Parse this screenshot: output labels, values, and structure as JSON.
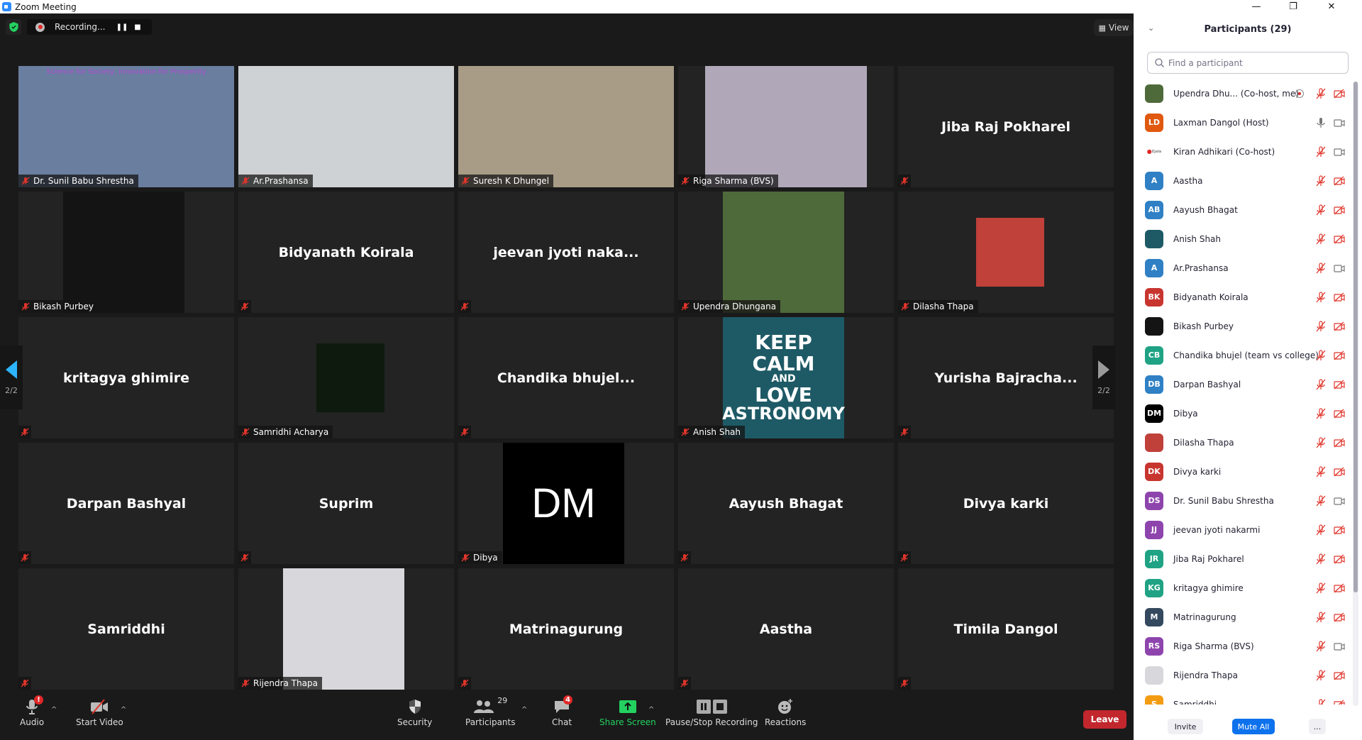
{
  "window": {
    "title": "Zoom Meeting",
    "minimize": "—",
    "restore": "❐",
    "close": "✕"
  },
  "topbar": {
    "recording_label": "Recording...",
    "view_label": "View"
  },
  "pagination": {
    "left": "2/2",
    "right": "2/2"
  },
  "tiles": [
    {
      "name": "Dr. Sunil Babu Shrestha",
      "video": true,
      "bg": "#6a7ea0",
      "banner": "Science for Society, Innovation for Prosperity"
    },
    {
      "name": "Ar.Prashansa",
      "video": true,
      "bg": "#cfd2d4"
    },
    {
      "name": "Suresh K Dhungel",
      "video": true,
      "bg": "#a89c86"
    },
    {
      "name": "Riga Sharma (BVS)",
      "video": true,
      "bg": "#b0a8b8"
    },
    {
      "name": "Jiba Raj Pokharel",
      "video": false
    },
    {
      "name": "Bikash Purbey",
      "video": true,
      "bg": "#141414"
    },
    {
      "name": "Bidyanath Koirala",
      "video": false
    },
    {
      "name": "jeevan jyoti naka...",
      "video": false
    },
    {
      "name": "Upendra Dhungana",
      "video": true,
      "bg": "#4f6a3a"
    },
    {
      "name": "Dilasha Thapa",
      "video": true,
      "bg": "#c0403a"
    },
    {
      "name": "kritagya ghimire",
      "video": false
    },
    {
      "name": "Samridhi Acharya",
      "video": true,
      "bg": "#0d1a0d"
    },
    {
      "name": "Chandika  bhujel...",
      "video": false
    },
    {
      "name": "Anish Shah",
      "video": true,
      "bg": "#1e5a66",
      "poster": [
        "KEEP",
        "CALM",
        "AND",
        "LOVE",
        "ASTRONOMY"
      ]
    },
    {
      "name": "Yurisha  Bajracha...",
      "video": false
    },
    {
      "name": "Darpan Bashyal",
      "video": false
    },
    {
      "name": "Suprim",
      "video": false
    },
    {
      "name": "Dibya",
      "video": true,
      "bg": "#000000",
      "initials": "DM"
    },
    {
      "name": "Aayush Bhagat",
      "video": false
    },
    {
      "name": "Divya karki",
      "video": false
    },
    {
      "name": "Samriddhi",
      "video": false
    },
    {
      "name": "Rijendra Thapa",
      "video": true,
      "bg": "#d8d8dc"
    },
    {
      "name": "Matrinagurung",
      "video": false
    },
    {
      "name": "Aastha",
      "video": false
    },
    {
      "name": "Timila Dangol",
      "video": false
    }
  ],
  "toolbar": {
    "audio": "Audio",
    "audio_badge": "!",
    "video": "Start Video",
    "security": "Security",
    "participants": "Participants",
    "participants_count": "29",
    "chat": "Chat",
    "chat_badge": "4",
    "share": "Share Screen",
    "recording": "Pause/Stop Recording",
    "reactions": "Reactions",
    "leave": "Leave"
  },
  "panel": {
    "title": "Participants (29)",
    "search_placeholder": "Find a participant",
    "participants": [
      {
        "name": "Upendra Dhu... (Co-host, me)",
        "initials": "",
        "color": "#4f6a3a",
        "mic": "off",
        "cam": "off",
        "recording": true
      },
      {
        "name": "Laxman Dangol (Host)",
        "initials": "LD",
        "color": "#e0590f",
        "mic": "on",
        "cam": "on"
      },
      {
        "name": "Kiran Adhikari (Co-host)",
        "initials": "",
        "color": "#ffffff",
        "mic": "off",
        "cam": "on"
      },
      {
        "name": "Aastha",
        "initials": "A",
        "color": "#2f80c4",
        "mic": "off",
        "cam": "off"
      },
      {
        "name": "Aayush Bhagat",
        "initials": "AB",
        "color": "#2f80c4",
        "mic": "off",
        "cam": "off"
      },
      {
        "name": "Anish Shah",
        "initials": "",
        "color": "#1e5a66",
        "mic": "off",
        "cam": "off"
      },
      {
        "name": "Ar.Prashansa",
        "initials": "A",
        "color": "#2f80c4",
        "mic": "off",
        "cam": "on"
      },
      {
        "name": "Bidyanath Koirala",
        "initials": "BK",
        "color": "#c8352f",
        "mic": "off",
        "cam": "off"
      },
      {
        "name": "Bikash Purbey",
        "initials": "",
        "color": "#141414",
        "mic": "off",
        "cam": "off"
      },
      {
        "name": "Chandika bhujel (team vs college)",
        "initials": "CB",
        "color": "#1fa384",
        "mic": "off",
        "cam": "off"
      },
      {
        "name": "Darpan Bashyal",
        "initials": "DB",
        "color": "#2f80c4",
        "mic": "off",
        "cam": "off"
      },
      {
        "name": "Dibya",
        "initials": "DM",
        "color": "#000000",
        "mic": "off",
        "cam": "off"
      },
      {
        "name": "Dilasha Thapa",
        "initials": "",
        "color": "#c0403a",
        "mic": "off",
        "cam": "off"
      },
      {
        "name": "Divya karki",
        "initials": "DK",
        "color": "#c8352f",
        "mic": "off",
        "cam": "off"
      },
      {
        "name": "Dr. Sunil Babu Shrestha",
        "initials": "DS",
        "color": "#8e44ad",
        "mic": "off",
        "cam": "on"
      },
      {
        "name": "jeevan jyoti nakarmi",
        "initials": "JJ",
        "color": "#8e44ad",
        "mic": "off",
        "cam": "off"
      },
      {
        "name": "Jiba Raj Pokharel",
        "initials": "JR",
        "color": "#1fa384",
        "mic": "off",
        "cam": "off"
      },
      {
        "name": "kritagya ghimire",
        "initials": "KG",
        "color": "#1fa384",
        "mic": "off",
        "cam": "off"
      },
      {
        "name": "Matrinagurung",
        "initials": "M",
        "color": "#34495e",
        "mic": "off",
        "cam": "off"
      },
      {
        "name": "Riga Sharma (BVS)",
        "initials": "RS",
        "color": "#8e44ad",
        "mic": "off",
        "cam": "on"
      },
      {
        "name": "Rijendra Thapa",
        "initials": "",
        "color": "#d8d8dc",
        "mic": "off",
        "cam": "off"
      },
      {
        "name": "Samriddhi",
        "initials": "S",
        "color": "#f39c12",
        "mic": "off",
        "cam": "off"
      }
    ],
    "invite": "Invite",
    "mute_all": "Mute All",
    "more": "..."
  },
  "colors": {
    "accent": "#0e72ed",
    "danger": "#c1272d",
    "share_green": "#22c55e",
    "muted_red": "#e0352b"
  }
}
